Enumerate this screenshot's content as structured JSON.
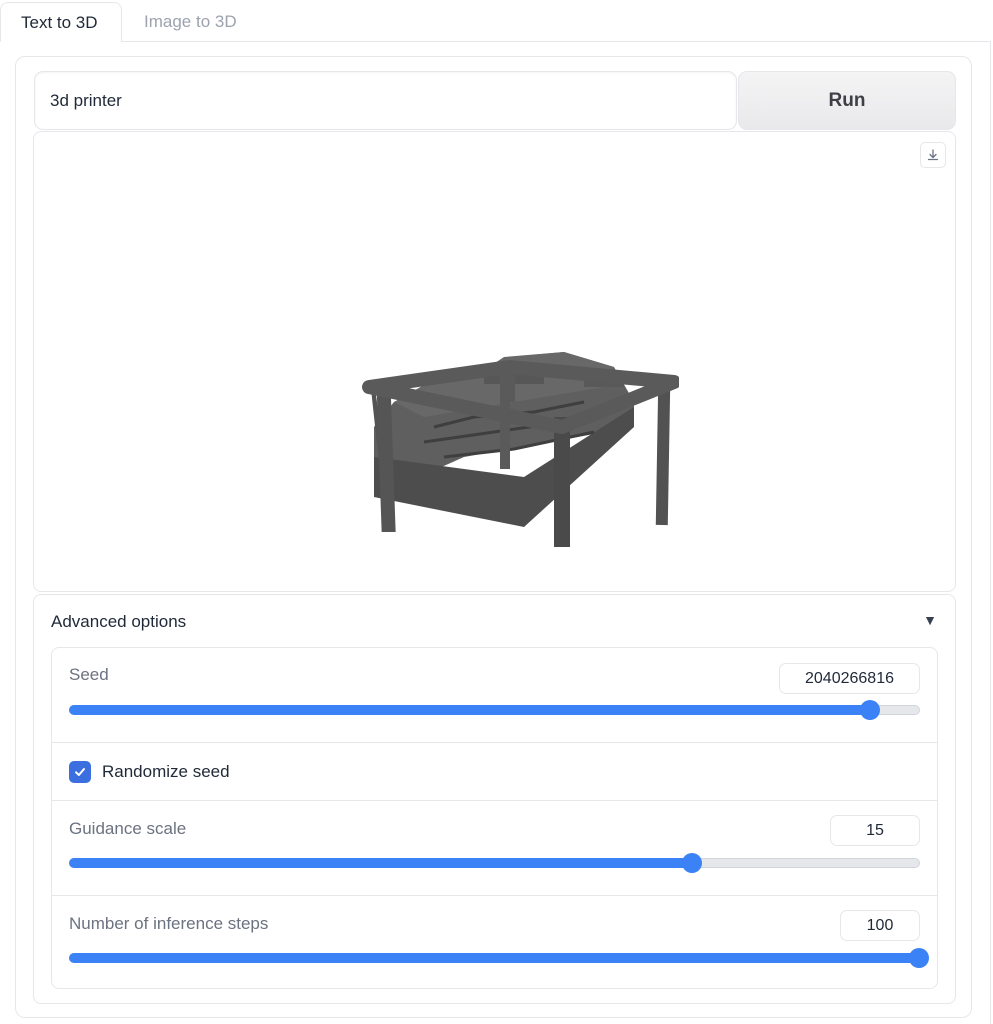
{
  "tabs": [
    {
      "label": "Text to 3D",
      "active": true
    },
    {
      "label": "Image to 3D",
      "active": false
    }
  ],
  "prompt": {
    "value": "3d printer",
    "placeholder": ""
  },
  "run_button": {
    "label": "Run"
  },
  "viewer": {
    "download_icon": "download-icon",
    "model": "3d printer mesh preview"
  },
  "advanced": {
    "title": "Advanced options",
    "caret_icon": "triangle-down-icon",
    "seed": {
      "label": "Seed",
      "value": "2040266816",
      "fraction": 0.942
    },
    "randomize": {
      "label": "Randomize seed",
      "checked": true
    },
    "guidance": {
      "label": "Guidance scale",
      "value": "15",
      "fraction": 0.733
    },
    "steps": {
      "label": "Number of inference steps",
      "value": "100",
      "fraction": 1.0
    }
  },
  "colors": {
    "accent": "#3b82f6",
    "checkbox": "#3b6fe0",
    "border": "#e5e7eb"
  }
}
